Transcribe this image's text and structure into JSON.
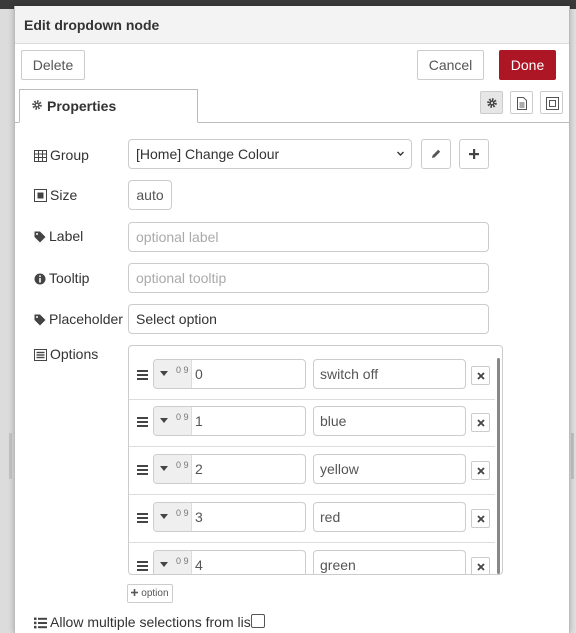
{
  "dialog": {
    "title": "Edit dropdown node",
    "buttons": {
      "delete": "Delete",
      "cancel": "Cancel",
      "done": "Done"
    },
    "tabs": [
      {
        "label": "Properties"
      }
    ],
    "tab_icons": [
      "gear-icon",
      "file-text-icon",
      "frame-icon"
    ]
  },
  "form": {
    "group": {
      "label": "Group",
      "value": "[Home] Change Colour"
    },
    "size": {
      "label": "Size",
      "value": "auto"
    },
    "label": {
      "label": "Label",
      "placeholder": "optional label",
      "value": ""
    },
    "tooltip": {
      "label": "Tooltip",
      "placeholder": "optional tooltip",
      "value": ""
    },
    "placeholder": {
      "label": "Placeholder",
      "value": "Select option"
    },
    "options": {
      "label": "Options",
      "type_glyph": "0 9",
      "items": [
        {
          "value": "0",
          "label": "switch off"
        },
        {
          "value": "1",
          "label": "blue"
        },
        {
          "value": "2",
          "label": "yellow"
        },
        {
          "value": "3",
          "label": "red"
        },
        {
          "value": "4",
          "label": "green"
        }
      ],
      "add_label": "option"
    },
    "multiple": {
      "label": "Allow multiple selections from list:",
      "checked": false
    }
  },
  "colors": {
    "accent": "#ad1625",
    "header_bg": "#f3f3f3",
    "border": "#cccccc"
  }
}
